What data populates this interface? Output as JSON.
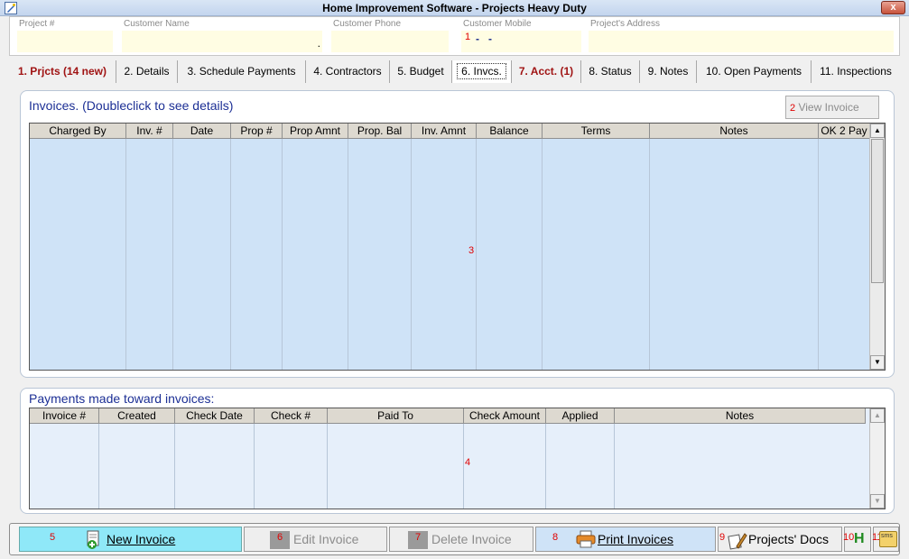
{
  "window": {
    "title": "Home Improvement Software - Projects Heavy Duty",
    "close_label": "x"
  },
  "header": {
    "fields": [
      {
        "label": "Project #",
        "value": ""
      },
      {
        "label": "Customer Name",
        "value": "."
      },
      {
        "label": "Customer Phone",
        "value": ""
      },
      {
        "label": "Customer Mobile",
        "value": "-   -",
        "marker": "1"
      },
      {
        "label": "Project's Address",
        "value": ""
      }
    ]
  },
  "tabs": [
    {
      "label": "1. Prjcts (14 new)",
      "highlight": true
    },
    {
      "label": "2. Details"
    },
    {
      "label": "3. Schedule Payments"
    },
    {
      "label": "4. Contractors"
    },
    {
      "label": "5. Budget"
    },
    {
      "label": "6. Invcs.",
      "active": true
    },
    {
      "label": "7. Acct. (1)",
      "highlight": true
    },
    {
      "label": "8. Status"
    },
    {
      "label": "9. Notes"
    },
    {
      "label": "10. Open Payments"
    },
    {
      "label": "11. Inspections"
    }
  ],
  "invoices": {
    "title": "Invoices.  (Doubleclick to see details)",
    "view_button": {
      "label": "View Invoice",
      "marker": "2"
    },
    "grid_marker": "3",
    "columns": [
      "Charged By",
      "Inv. #",
      "Date",
      "Prop #",
      "Prop Amnt",
      "Prop. Bal",
      "Inv. Amnt",
      "Balance",
      "Terms",
      "Notes",
      "OK 2 Pay"
    ],
    "rows": []
  },
  "payments": {
    "title": "Payments made toward invoices:",
    "grid_marker": "4",
    "columns": [
      "Invoice #",
      "Created",
      "Check Date",
      "Check #",
      "Paid To",
      "Check Amount",
      "Applied",
      "Notes"
    ],
    "rows": []
  },
  "toolbar": {
    "new_invoice": {
      "marker": "5",
      "label": "New Invoice"
    },
    "edit_invoice": {
      "marker": "6",
      "label": "Edit Invoice"
    },
    "delete_invoice": {
      "marker": "7",
      "label": "Delete Invoice"
    },
    "print_invoices": {
      "marker": "8",
      "label": "Print Invoices"
    },
    "projects_docs": {
      "marker": "9",
      "label": "Projects' Docs"
    },
    "help": {
      "marker": "10",
      "label": "H"
    },
    "sms": {
      "marker": "11",
      "label": "sms"
    }
  },
  "colors": {
    "accent_blue": "#1c2f95",
    "grid_fill": "#cfe3f7",
    "highlight_red": "#a01414",
    "field_fill": "#fffde3",
    "new_invoice_fill": "#8fe8f8"
  }
}
